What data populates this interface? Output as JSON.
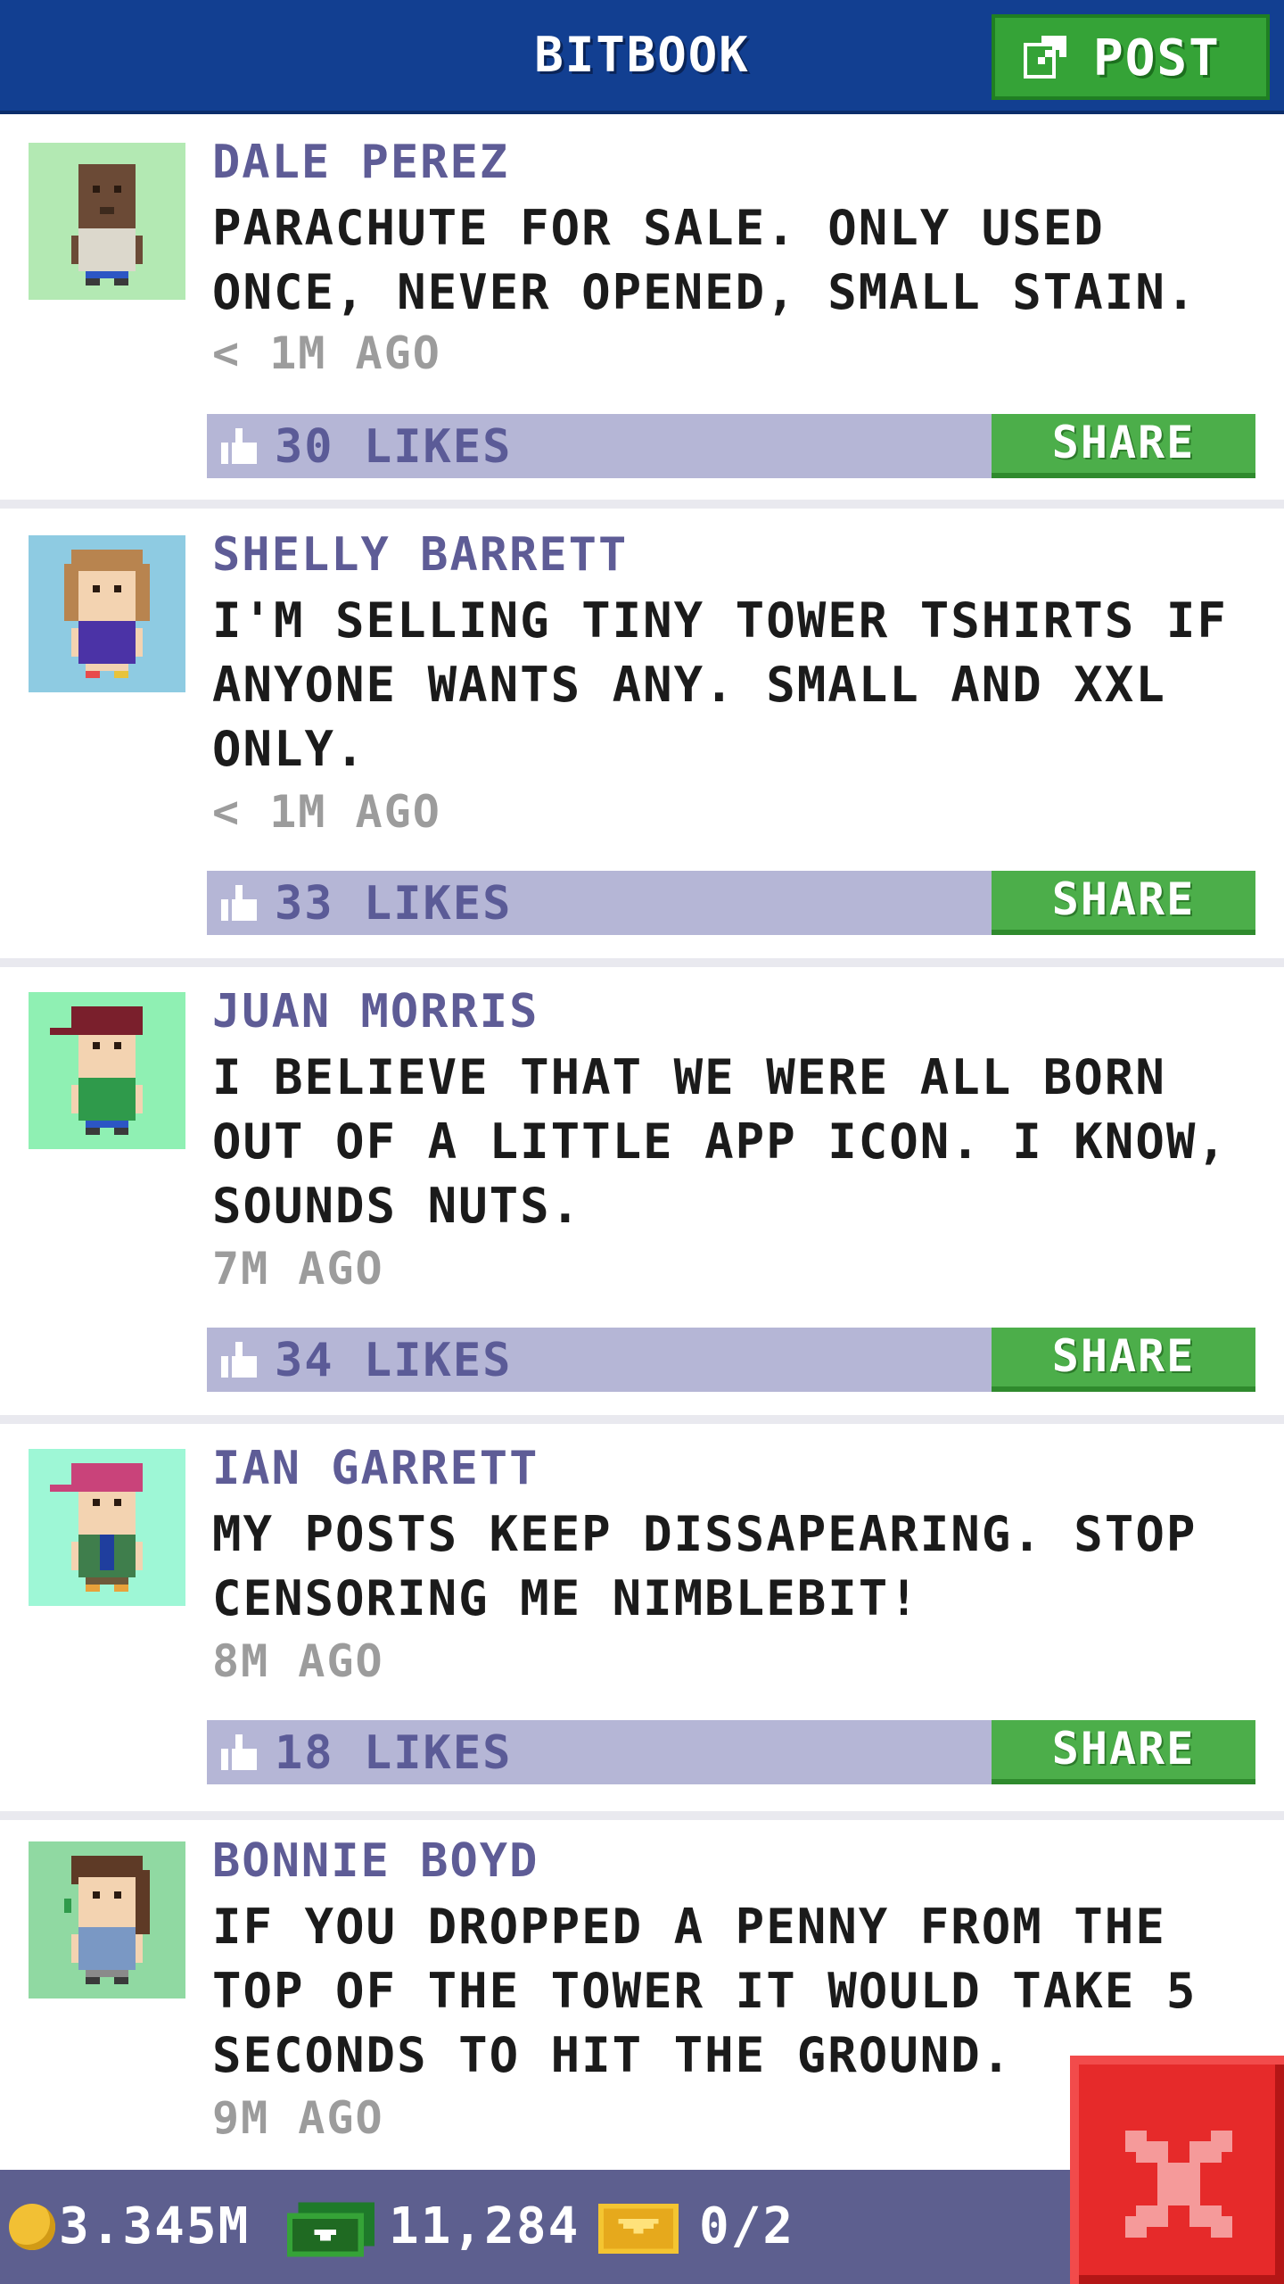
{
  "app": {
    "title": "BITBOOK"
  },
  "header": {
    "post_label": "POST"
  },
  "posts": [
    {
      "author": "DALE PEREZ",
      "text": "PARACHUTE FOR SALE. ONLY USED ONCE, NEVER OPENED, SMALL STAIN.",
      "time": "< 1M AGO",
      "likes": "30 LIKES",
      "share": "SHARE",
      "avatar_bg": "#b3e9b3"
    },
    {
      "author": "SHELLY BARRETT",
      "text": "I'M SELLING TINY TOWER TSHIRTS IF ANYONE WANTS ANY. SMALL AND XXL ONLY.",
      "time": "< 1M AGO",
      "likes": "33 LIKES",
      "share": "SHARE",
      "avatar_bg": "#8ecbe2"
    },
    {
      "author": "JUAN MORRIS",
      "text": "I BELIEVE THAT WE WERE ALL BORN OUT OF A LITTLE APP ICON. I KNOW, SOUNDS NUTS.",
      "time": "7M AGO",
      "likes": "34 LIKES",
      "share": "SHARE",
      "avatar_bg": "#8ff0b3"
    },
    {
      "author": "IAN GARRETT",
      "text": "MY POSTS KEEP DISSAPEARING. STOP CENSORING ME NIMBLEBIT!",
      "time": "8M AGO",
      "likes": "18 LIKES",
      "share": "SHARE",
      "avatar_bg": "#9ef7d6"
    },
    {
      "author": "BONNIE BOYD",
      "text": "IF YOU DROPPED A PENNY FROM THE TOP OF THE TOWER IT WOULD TAKE 5 SECONDS TO HIT THE GROUND.",
      "time": "9M AGO",
      "avatar_bg": "#90d9a2"
    }
  ],
  "status": {
    "coins": "3.345M",
    "bux": "11,284",
    "tickets": "0/2"
  },
  "icons": {
    "post": "edit-icon",
    "like": "thumbs-up-icon",
    "coin": "coin-icon",
    "bux": "bux-icon",
    "ticket": "golden-ticket-icon",
    "close": "close-icon"
  },
  "colors": {
    "header": "#123f91",
    "accent_green": "#35a337",
    "likes_bar": "#b5b6d6",
    "author": "#5e5c96",
    "close": "#e62a2a"
  }
}
